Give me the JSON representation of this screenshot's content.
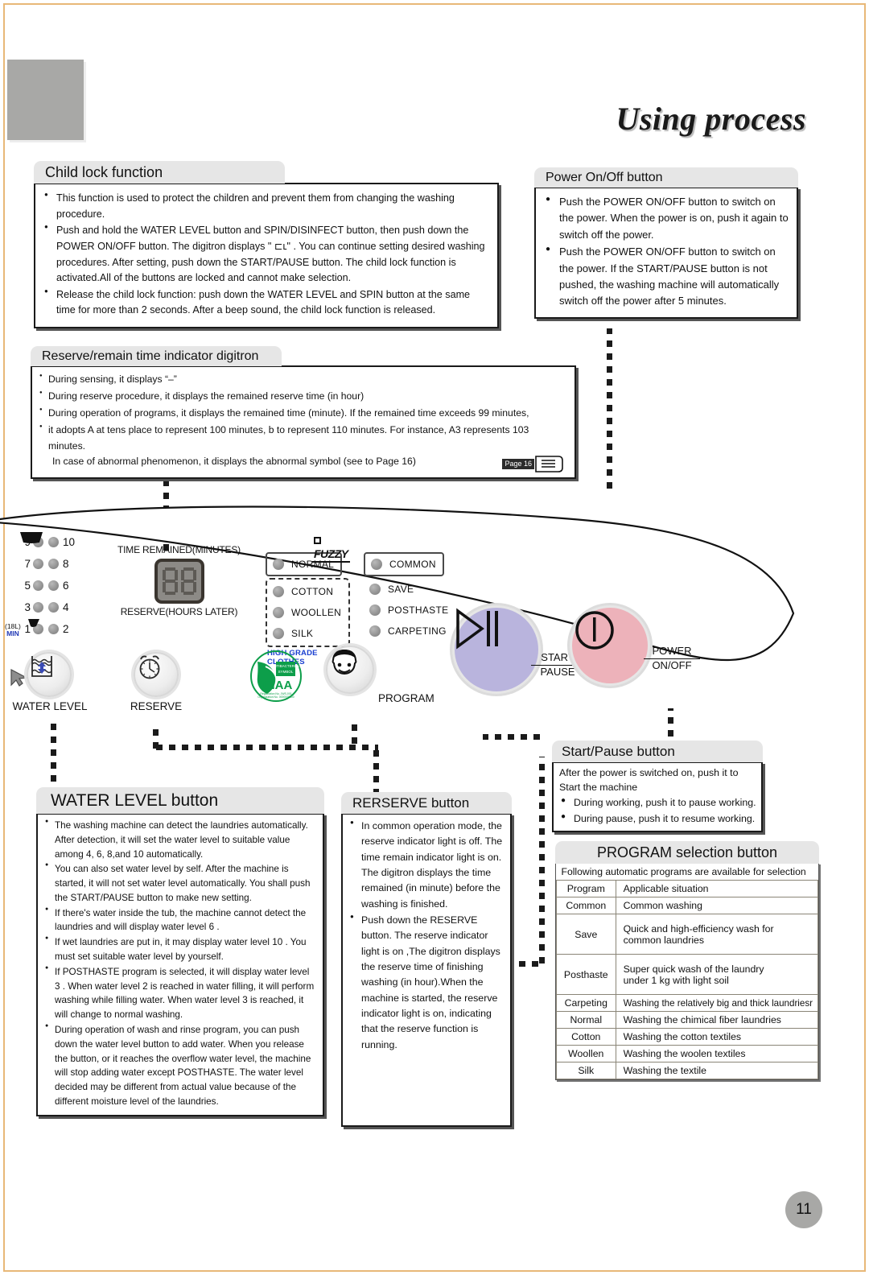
{
  "page": {
    "title": "Using process",
    "number": "11"
  },
  "child_lock": {
    "header": "Child lock function",
    "items": [
      "This function is used to protect the children and prevent them from changing  the washing procedure.",
      "Push and hold the  WATER LEVEL  button and  SPIN/DISINFECT  button, then push down the POWER ON/OFF button. The digitron displays \" ⊏ʟ\" . You can continue setting desired washing procedures. After setting, push down the  START/PAUSE  button. The child lock function is activated.All of the buttons are locked and cannot make selection.",
      "Release the child lock function: push down the WATER LEVEL  and SPIN  button at the same time for more than 2 seconds. After a beep sound, the child lock function is released."
    ]
  },
  "power_button": {
    "header": "Power On/Off  button",
    "items": [
      "Push the  POWER ON/OFF  button to switch on the power. When the power is on, push it again  to switch off the power.",
      "Push the  POWER ON/OFF  button to switch on the power. If the  START/PAUSE  button is not pushed, the washing machine will automatically switch off the power after 5 minutes."
    ]
  },
  "digitron": {
    "header": "Reserve/remain time indicator digitron",
    "items": [
      "During sensing, it displays  “–”",
      "During reserve procedure, it displays the remained reserve time (in hour)",
      "During operation of programs, it displays the remained time (minute). If the remained time exceeds 99 minutes,",
      "it adopts  A  at tens place to represent 100 minutes,  b to represent 110 minutes. For instance,  A3  represents 103 minutes."
    ],
    "continuation": "In case of abnormal phenomenon, it displays the abnormal symbol (see to Page 16)",
    "page_ref": "Page 16"
  },
  "panel": {
    "water_levels": [
      {
        "left": "9",
        "right": "10"
      },
      {
        "left": "7",
        "right": "8"
      },
      {
        "left": "5",
        "right": "6"
      },
      {
        "left": "3",
        "right": "4"
      },
      {
        "left": "1",
        "right": "2"
      }
    ],
    "min_label_line1": "(18L)",
    "min_label_line2": "MIN",
    "time_remained_label": "TIME REMAINED(MINUTES)",
    "reserve_hours_label": "RESERVE(HOURS LATER)",
    "fuzzy_label": "FUZZY",
    "program_col_left": [
      "NORMAL",
      "COTTON",
      "WOOLLEN",
      "SILK"
    ],
    "program_col_right": [
      "COMMON",
      "SAVE",
      "POSTHASTE",
      "CARPETING"
    ],
    "high_grade_clothes": "HIGH GRADE CLOTHES",
    "ciaa_logo": "CIAA",
    "ciaa_sub1": "ANTIBACTERIAL",
    "ciaa_sub2": "SYMBOL",
    "water_level_caption": "WATER LEVEL",
    "reserve_caption": "RESERVE",
    "program_caption": "PROGRAM",
    "start_caption_top": "START",
    "start_caption_bottom": "PAUSE",
    "power_caption_top": "POWER",
    "power_caption_bottom": "ON/OFF"
  },
  "water_level_box": {
    "header": "WATER LEVEL  button",
    "items": [
      "The washing machine can detect the laundries automatically. After detection, it will set the water level to suitable value among 4, 6, 8,and 10 automatically.",
      "You can also set water level by self. After the machine is started, it will not set water level automatically. You shall push the  START/PAUSE  button to make new setting.",
      "If there's water inside the tub, the machine cannot detect the laundries and will display water level  6 .",
      "If wet laundries are put in, it may display water level  10 . You must set suitable water level by yourself.",
      "If  POSTHASTE  program is selected, it will display water level  3 . When water level  2  is reached in water filling, it will perform washing while filling water. When water level  3  is reached, it will change to normal washing.",
      "During operation of  wash  and  rinse  program, you can push down the water level  button to add water. When you release the button, or it reaches the overflow water level, the machine will stop adding water except POSTHASTE. The water level decided may be different from actual value because of the different moisture level of the laundries."
    ]
  },
  "reserve_box": {
    "header": "RERSERVE  button",
    "items": [
      "In common  operation mode, the reserve  indicator light is off. The time remain indicator light is on. The digitron displays the time remained (in minute) before the washing is finished.",
      "Push down the  RESERVE  button. The  reserve indicator light is on ,The digitron displays the reserve time of finishing washing (in hour).When the machine is started, the reserve indicator light is  on, indicating that the reserve function is running."
    ]
  },
  "start_pause_box": {
    "header": "Start/Pause  button",
    "intro": "After the power is switched on, push it to Start the machine",
    "items": [
      "During working, push it to pause working.",
      "During pause, push it to resume working."
    ]
  },
  "program_selection": {
    "header": "PROGRAM  selection button",
    "intro": "Following automatic programs are available for selection",
    "columns": [
      "Program",
      "Applicable situation"
    ],
    "rows": [
      {
        "program": "Common",
        "situation": "Common washing"
      },
      {
        "program": "Save",
        "situation": "Quick and high-efficiency wash for\n common laundries"
      },
      {
        "program": "Posthaste",
        "situation": "Super quick wash of the laundry\nunder 1 kg with light soil"
      },
      {
        "program": "Carpeting",
        "situation": "Washing the relatively big and thick laundriesr"
      },
      {
        "program": "Normal",
        "situation": "Washing the chimical fiber laundries"
      },
      {
        "program": "Cotton",
        "situation": "Washing the cotton textiles"
      },
      {
        "program": "Woollen",
        "situation": " Washing the woolen textiles"
      },
      {
        "program": "Silk",
        "situation": "Washing the textile"
      }
    ]
  },
  "colors": {
    "page_border": "#e8b878",
    "corner_block": "#a8a8a6",
    "start_button": "#b9b4dd",
    "power_button": "#edb2ba",
    "header_band": "#e6e6e6",
    "accent_blue": "#1a3fd0",
    "ciaa_green": "#0d9e4a"
  }
}
